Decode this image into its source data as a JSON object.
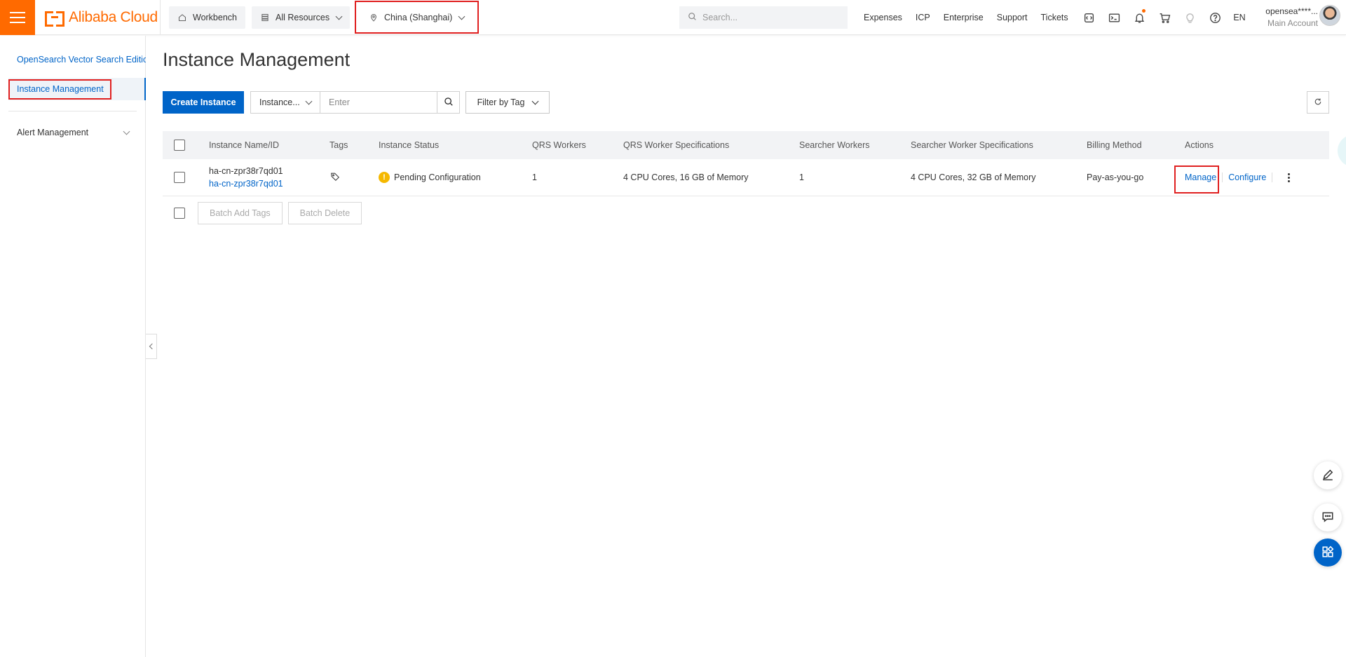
{
  "header": {
    "brand": "Alibaba Cloud",
    "workbench": "Workbench",
    "all_resources": "All Resources",
    "region": "China (Shanghai)",
    "search_placeholder": "Search...",
    "links": [
      "Expenses",
      "ICP",
      "Enterprise",
      "Support",
      "Tickets"
    ],
    "lang": "EN",
    "account_name": "opensea****...",
    "account_type": "Main Account"
  },
  "sidebar": {
    "product_title": "OpenSearch Vector Search Edition",
    "active_item": "Instance Management",
    "items": [
      {
        "label": "Alert Management"
      }
    ]
  },
  "main": {
    "title": "Instance Management",
    "create_button": "Create Instance",
    "search_field_select": "Instance...",
    "search_placeholder": "Enter",
    "filter_by_tag": "Filter by Tag"
  },
  "table": {
    "columns": [
      "Instance Name/ID",
      "Tags",
      "Instance Status",
      "QRS Workers",
      "QRS Worker Specifications",
      "Searcher Workers",
      "Searcher Worker Specifications",
      "Billing Method",
      "Actions"
    ],
    "rows": [
      {
        "name": "ha-cn-zpr38r7qd01",
        "id": "ha-cn-zpr38r7qd01",
        "status": "Pending Configuration",
        "qrs_workers": "1",
        "qrs_spec": "4 CPU Cores, 16 GB of Memory",
        "searcher_workers": "1",
        "searcher_spec": "4 CPU Cores, 32 GB of Memory",
        "billing": "Pay-as-you-go",
        "action_manage": "Manage",
        "action_configure": "Configure"
      }
    ]
  },
  "batch": {
    "add_tags": "Batch Add Tags",
    "delete": "Batch Delete"
  },
  "colors": {
    "brand_orange": "#ff6a00",
    "primary_blue": "#0064c8",
    "highlight_red": "#e02020",
    "warning_yellow": "#f5b800"
  }
}
